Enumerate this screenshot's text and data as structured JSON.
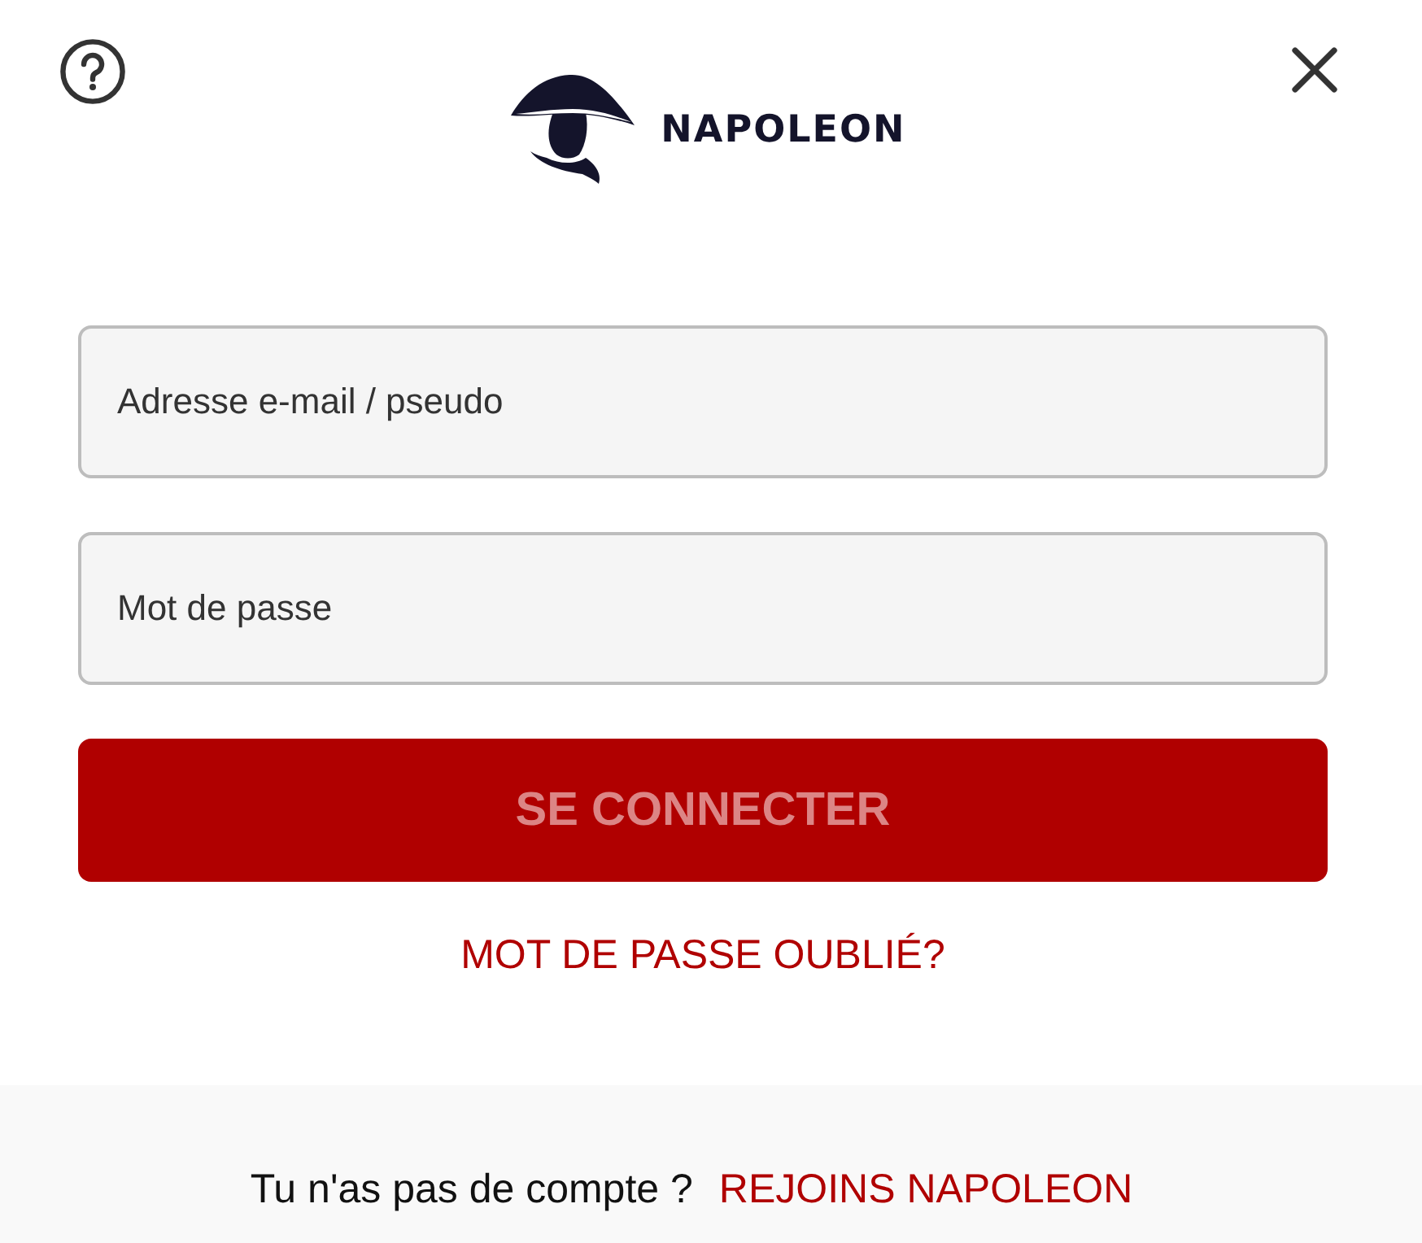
{
  "header": {
    "logo_text": "NAPOLEON"
  },
  "form": {
    "fields": [
      {
        "placeholder": "Adresse e-mail / pseudo"
      },
      {
        "placeholder": "Mot de passe"
      }
    ],
    "submit": {
      "label": "SE CONNECTER",
      "disabled": true
    },
    "forgot_link": "MOT DE PASSE OUBLIÉ?"
  },
  "footer": {
    "prompt": "Tu n'as pas de compte ?",
    "link": "REJOINS NAPOLEON"
  }
}
